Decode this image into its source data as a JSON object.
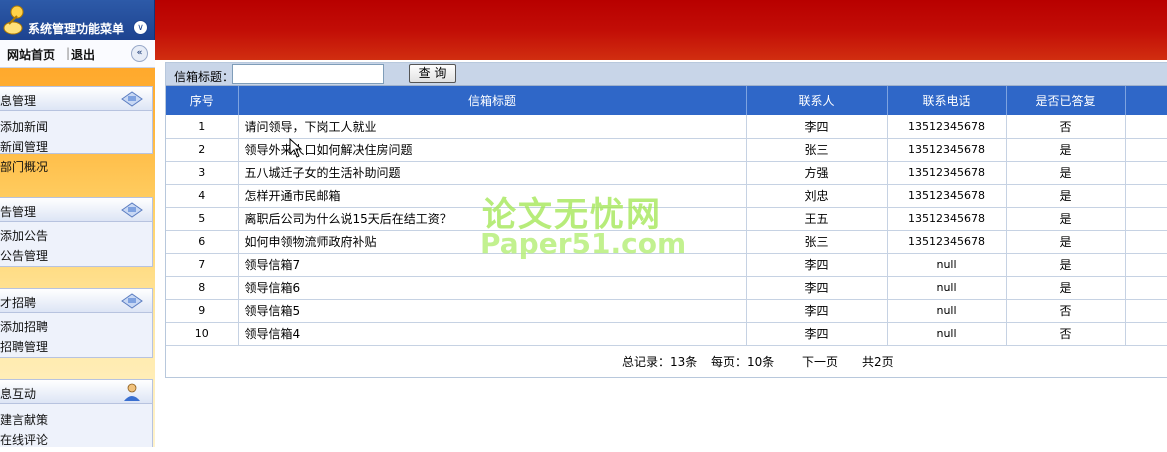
{
  "sidebar": {
    "title": "系统管理功能菜单",
    "home_link": "网站首页",
    "separator": "|",
    "logout_link": "退出",
    "sections": [
      {
        "title": "信息管理",
        "title_visible": "息管理",
        "icon": "monitor-icon",
        "items": [
          "添加新闻",
          "新闻管理",
          "部门概况"
        ]
      },
      {
        "title": "公告管理",
        "title_visible": "告管理",
        "icon": "monitor-icon",
        "items": [
          "添加公告",
          "公告管理"
        ]
      },
      {
        "title": "人才招聘",
        "title_visible": "才招聘",
        "icon": "monitor-icon",
        "items": [
          "添加招聘",
          "招聘管理"
        ]
      },
      {
        "title": "信息互动",
        "title_visible": "息互动",
        "icon": "user-icon",
        "items": [
          "建言献策",
          "在线评论"
        ]
      }
    ]
  },
  "search": {
    "label": "信箱标题：",
    "value": "",
    "button_label": "查 询"
  },
  "table": {
    "headers": [
      "序号",
      "信箱标题",
      "联系人",
      "联系电话",
      "是否已答复"
    ],
    "rows": [
      [
        "1",
        "请问领导，下岗工人就业",
        "李四",
        "13512345678",
        "否"
      ],
      [
        "2",
        "领导外来人口如何解决住房问题",
        "张三",
        "13512345678",
        "是"
      ],
      [
        "3",
        "五八城迁子女的生活补助问题",
        "方强",
        "13512345678",
        "是"
      ],
      [
        "4",
        "怎样开通市民邮箱",
        "刘忠",
        "13512345678",
        "是"
      ],
      [
        "5",
        "离职后公司为什么说15天后在结工资？",
        "王五",
        "13512345678",
        "是"
      ],
      [
        "6",
        "如何申领物流师政府补贴",
        "张三",
        "13512345678",
        "是"
      ],
      [
        "7",
        "领导信箱7",
        "李四",
        "null",
        "是"
      ],
      [
        "8",
        "领导信箱6",
        "李四",
        "null",
        "是"
      ],
      [
        "9",
        "领导信箱5",
        "李四",
        "null",
        "否"
      ],
      [
        "10",
        "领导信箱4",
        "李四",
        "null",
        "否"
      ]
    ]
  },
  "pager": {
    "total": "总记录：13条",
    "per_page": "每页：10条",
    "next": "下一页",
    "pages": "共2页"
  },
  "watermark": {
    "line1": "论文无忧网",
    "line2": "Paper51.com"
  },
  "colors": {
    "banner_red": "#c20d06",
    "table_header_blue": "#2f67c8",
    "sidebar_orange": "#ffb43a",
    "menu_header_blue": "#1d4390"
  }
}
